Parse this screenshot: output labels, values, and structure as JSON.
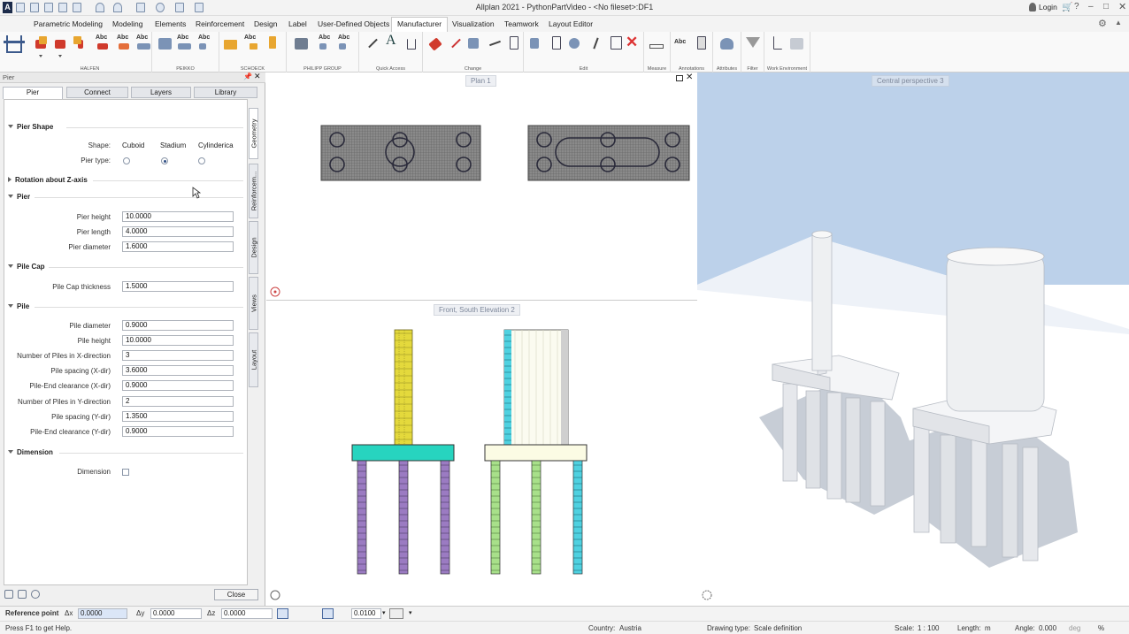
{
  "app": {
    "title": "Allplan 2021 - PythonPartVideo - <No fileset>:DF1",
    "login": "Login"
  },
  "menu": {
    "items": [
      "Parametric Modeling",
      "Modeling",
      "Elements",
      "Reinforcement",
      "Design",
      "Label",
      "User-Defined Objects",
      "Manufacturer",
      "Visualization",
      "Teamwork",
      "Layout Editor"
    ],
    "active": "Manufacturer"
  },
  "ribbon": {
    "groups": [
      "HALFEN",
      "PEIKKO",
      "SCHOECK",
      "PHILIPP GROUP",
      "Quick Access",
      "Change",
      "Edit",
      "Measure",
      "Annotations",
      "Attributes",
      "Filter",
      "Work Environment"
    ]
  },
  "panel": {
    "title": "Pier",
    "tabs": [
      "Pier",
      "Connect",
      "Layers",
      "Library"
    ],
    "side_tabs": [
      "Geometry",
      "Reinforcem...",
      "Design",
      "Views",
      "Layout"
    ],
    "sections": {
      "pier_shape": "Pier Shape",
      "rotation": "Rotation about Z-axis",
      "pier": "Pier",
      "pile_cap": "Pile Cap",
      "pile": "Pile",
      "dimension": "Dimension"
    },
    "shape": {
      "label": "Shape:",
      "options": [
        "Cuboid",
        "Stadium",
        "Cylinderica"
      ],
      "type_label": "Pier type:",
      "selected": 1
    },
    "pier_fields": [
      {
        "label": "Pier height",
        "value": "10.0000"
      },
      {
        "label": "Pier length",
        "value": "4.0000"
      },
      {
        "label": "Pier diameter",
        "value": "1.6000"
      }
    ],
    "pile_cap_fields": [
      {
        "label": "Pile Cap thickness",
        "value": "1.5000"
      }
    ],
    "pile_fields": [
      {
        "label": "Pile diameter",
        "value": "0.9000"
      },
      {
        "label": "Pile height",
        "value": "10.0000"
      },
      {
        "label": "Number of Piles in X-direction",
        "value": "3"
      },
      {
        "label": "Pile spacing (X-dir)",
        "value": "3.6000"
      },
      {
        "label": "Pile-End clearance (X-dir)",
        "value": "0.9000"
      },
      {
        "label": "Number of Piles in Y-direction",
        "value": "2"
      },
      {
        "label": "Pile spacing (Y-dir)",
        "value": "1.3500"
      },
      {
        "label": "Pile-End clearance (Y-dir)",
        "value": "0.9000"
      }
    ],
    "dimension_label": "Dimension",
    "close": "Close"
  },
  "views": {
    "plan": "Plan 1",
    "front": "Front, South Elevation 2",
    "perspective": "Central perspective 3"
  },
  "coordbar": {
    "ref_label": "Reference point",
    "dx_label": "Δx",
    "dx": "0.0000",
    "dy_label": "Δy",
    "dy": "0.0000",
    "dz_label": "Δz",
    "dz": "0.0000",
    "snap": "0.0100"
  },
  "status": {
    "help": "Press F1 to get Help.",
    "country_label": "Country:",
    "country": "Austria",
    "drawing_type_label": "Drawing type:",
    "drawing_type": "Scale definition",
    "scale_label": "Scale:",
    "scale": "1 : 100",
    "length_label": "Length:",
    "length": "m",
    "angle_label": "Angle:",
    "angle": "0.000",
    "angle_unit": "deg",
    "percent": "%"
  },
  "colors": {
    "accent": "#2e4e85",
    "sky": "#bcd1ea",
    "cap_cyan": "#27d4bf",
    "pier_yellow": "#e4d93c",
    "pile_purple": "#9b7bc2",
    "pile_green": "#a8e08a",
    "pile_cyan": "#4fd1e0"
  }
}
